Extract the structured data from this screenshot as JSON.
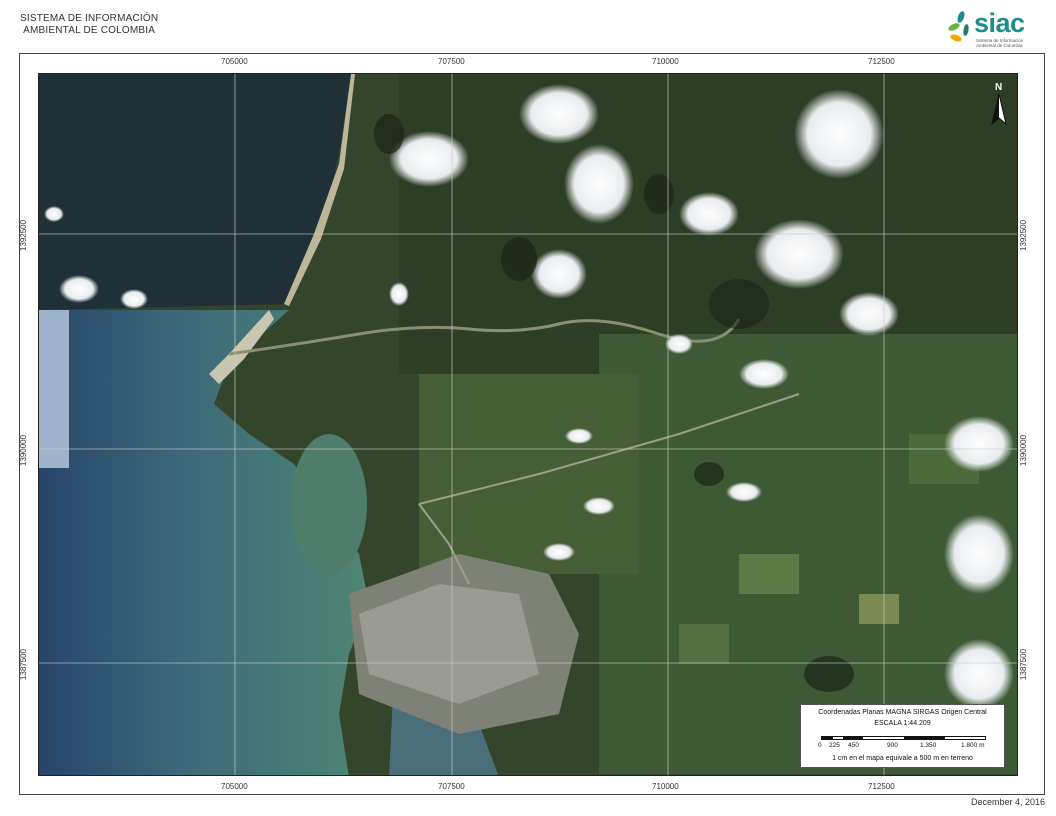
{
  "header": {
    "title_line1": "SISTEMA DE INFORMACIÓN",
    "title_line2": "AMBIENTAL DE COLOMBIA"
  },
  "logo": {
    "brand": "siac",
    "subtitle": "Sistema de Información Ambiental de Colombia",
    "colors": [
      "#6bb33e",
      "#1e8c8c",
      "#f2a900"
    ]
  },
  "axes": {
    "easting_ticks": [
      "705000",
      "707500",
      "710000",
      "712500"
    ],
    "northing_ticks": [
      "1392500",
      "1390000",
      "1387500"
    ]
  },
  "scale_box": {
    "line1": "Coordenadas Planas MAGNA SIRGAS Origen Central",
    "line2": "ESCALA   1:44.209",
    "bar_labels": [
      "0",
      "225",
      "450",
      "900",
      "1.350",
      "1.800 m"
    ],
    "line3": "1 cm en el mapa equivale a 500 m en terreno"
  },
  "north_arrow": {
    "letter": "N",
    "icon": "north-arrow-icon"
  },
  "footer": {
    "date": "December 4, 2016"
  }
}
